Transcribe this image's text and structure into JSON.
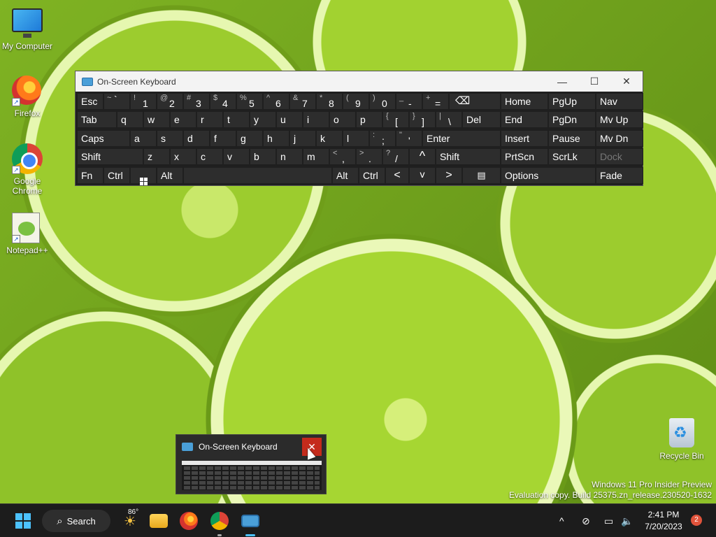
{
  "desktop": {
    "icons": [
      {
        "label": "My Computer"
      },
      {
        "label": "Firefox"
      },
      {
        "label": "Google Chrome"
      },
      {
        "label": "Notepad++"
      },
      {
        "label": "Recycle Bin"
      }
    ]
  },
  "osk": {
    "title": "On-Screen Keyboard",
    "minimize_glyph": "—",
    "maximize_glyph": "☐",
    "close_glyph": "✕",
    "keys": {
      "esc": "Esc",
      "tilde_s": "~",
      "tilde_b": "`",
      "k1_s": "!",
      "k1_b": "1",
      "k2_s": "@",
      "k2_b": "2",
      "k3_s": "#",
      "k3_b": "3",
      "k4_s": "$",
      "k4_b": "4",
      "k5_s": "%",
      "k5_b": "5",
      "k6_s": "^",
      "k6_b": "6",
      "k7_s": "&",
      "k7_b": "7",
      "k8_s": "*",
      "k8_b": "8",
      "k9_s": "(",
      "k9_b": "9",
      "k0_s": ")",
      "k0_b": "0",
      "minus_s": "_",
      "minus_b": "-",
      "equal_s": "+",
      "equal_b": "=",
      "backspace": "⌫",
      "home": "Home",
      "pgup": "PgUp",
      "nav": "Nav",
      "tab": "Tab",
      "q": "q",
      "w": "w",
      "e": "e",
      "r": "r",
      "t": "t",
      "y": "y",
      "u": "u",
      "i": "i",
      "o": "o",
      "p": "p",
      "lbracket_s": "{",
      "lbracket_b": "[",
      "rbracket_s": "}",
      "rbracket_b": "]",
      "backslash_s": "|",
      "backslash_b": "\\",
      "del": "Del",
      "end": "End",
      "pgdn": "PgDn",
      "mvup": "Mv Up",
      "caps": "Caps",
      "a": "a",
      "s": "s",
      "d": "d",
      "f": "f",
      "g": "g",
      "h": "h",
      "j": "j",
      "k": "k",
      "l": "l",
      "semicolon_s": ":",
      "semicolon_b": ";",
      "quote_s": "\"",
      "quote_b": "'",
      "enter": "Enter",
      "insert": "Insert",
      "pause": "Pause",
      "mvdn": "Mv Dn",
      "shift": "Shift",
      "z": "z",
      "x": "x",
      "c": "c",
      "v": "v",
      "b": "b",
      "n": "n",
      "m": "m",
      "comma_s": "<",
      "comma_b": ",",
      "period_s": ">",
      "period_b": ".",
      "slash_s": "?",
      "slash_b": "/",
      "up": "^",
      "shift_r": "Shift",
      "prtscn": "PrtScn",
      "scrlk": "ScrLk",
      "dock": "Dock",
      "fn": "Fn",
      "ctrl": "Ctrl",
      "alt": "Alt",
      "alt_r": "Alt",
      "ctrl_r": "Ctrl",
      "left": "<",
      "down": "v",
      "right": ">",
      "menu": "▤",
      "options": "Options",
      "fade": "Fade"
    }
  },
  "thumbnail": {
    "title": "On-Screen Keyboard",
    "close_glyph": "✕"
  },
  "watermark": {
    "line1": "Windows 11 Pro Insider Preview",
    "line2": "Evaluation copy. Build 25375.zn_release.230520-1632"
  },
  "taskbar": {
    "search_label": "Search",
    "weather_temp": "86°",
    "time": "2:41 PM",
    "date": "7/20/2023",
    "notification_count": "2",
    "tray_chevron": "^"
  }
}
